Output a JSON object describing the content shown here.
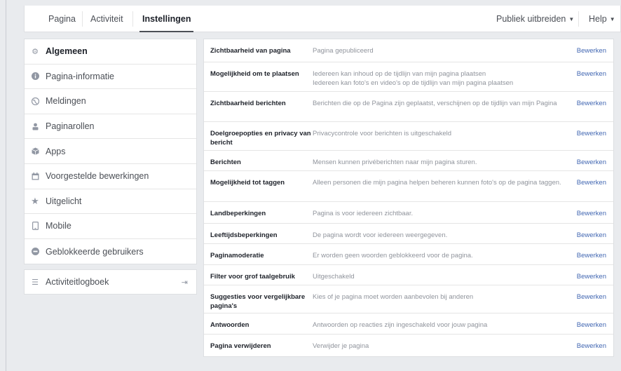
{
  "topnav": {
    "tabs": [
      {
        "label": "Pagina"
      },
      {
        "label": "Activiteit"
      },
      {
        "label": "Instellingen"
      }
    ],
    "right": {
      "promote": "Publiek uitbreiden",
      "help": "Help"
    }
  },
  "sidebar": {
    "items": [
      {
        "label": "Algemeen",
        "icon": "gear-icon"
      },
      {
        "label": "Pagina-informatie",
        "icon": "info-icon"
      },
      {
        "label": "Meldingen",
        "icon": "globe-icon"
      },
      {
        "label": "Paginarollen",
        "icon": "person-icon"
      },
      {
        "label": "Apps",
        "icon": "cube-icon"
      },
      {
        "label": "Voorgestelde bewerkingen",
        "icon": "calendar-icon"
      },
      {
        "label": "Uitgelicht",
        "icon": "star-icon"
      },
      {
        "label": "Mobile",
        "icon": "mobile-icon"
      },
      {
        "label": "Geblokkeerde gebruikers",
        "icon": "block-icon"
      }
    ],
    "log": {
      "label": "Activiteitlogboek",
      "icon": "list-icon"
    }
  },
  "settings": {
    "edit_label": "Bewerken",
    "rows": [
      {
        "label": "Zichtbaarheid van pagina",
        "value": "Pagina gepubliceerd"
      },
      {
        "label": "Mogelijkheid om te plaatsen",
        "value": "Iedereen kan inhoud op de tijdlijn van mijn pagina plaatsen",
        "value2": "Iedereen kan foto's en video's op de tijdlijn van mijn pagina plaatsen"
      },
      {
        "label": "Zichtbaarheid berichten",
        "value": "Berichten die op de Pagina zijn geplaatst, verschijnen op de tijdlijn van mijn Pagina"
      },
      {
        "label": "Doelgroepopties en privacy van bericht",
        "value": "Privacycontrole voor berichten is uitgeschakeld"
      },
      {
        "label": "Berichten",
        "value": "Mensen kunnen privéberichten naar mijn pagina sturen."
      },
      {
        "label": "Mogelijkheid tot taggen",
        "value": "Alleen personen die mijn pagina helpen beheren kunnen foto's op de pagina taggen."
      },
      {
        "label": "Landbeperkingen",
        "value": "Pagina is voor iedereen zichtbaar."
      },
      {
        "label": "Leeftijdsbeperkingen",
        "value": "De pagina wordt voor iedereen weergegeven."
      },
      {
        "label": "Paginamoderatie",
        "value": "Er worden geen woorden geblokkeerd voor de pagina."
      },
      {
        "label": "Filter voor grof taalgebruik",
        "value": "Uitgeschakeld"
      },
      {
        "label": "Suggesties voor vergelijkbare pagina's",
        "value": "Kies of je pagina moet worden aanbevolen bij anderen"
      },
      {
        "label": "Antwoorden",
        "value": "Antwoorden op reacties zijn ingeschakeld voor jouw pagina"
      },
      {
        "label": "Pagina verwijderen",
        "value": "Verwijder je pagina"
      }
    ]
  }
}
